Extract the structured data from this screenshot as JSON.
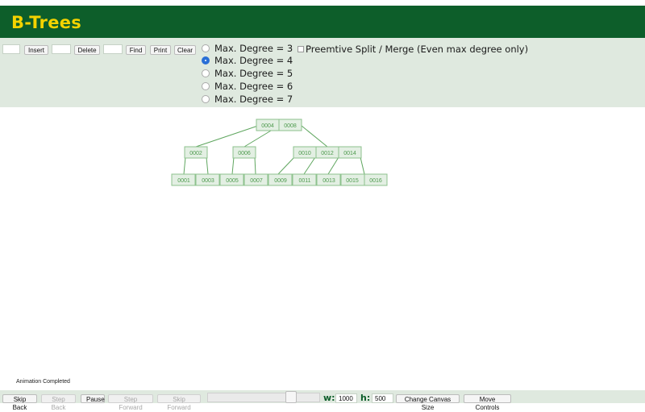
{
  "app": {
    "title": "B-Trees"
  },
  "controls": {
    "insert_label": "Insert",
    "delete_label": "Delete",
    "find_label": "Find",
    "print_label": "Print",
    "clear_label": "Clear",
    "insert_value": "",
    "delete_value": "",
    "find_value": "",
    "degrees": [
      {
        "label": "Max. Degree = 3",
        "selected": false
      },
      {
        "label": "Max. Degree = 4",
        "selected": true
      },
      {
        "label": "Max. Degree = 5",
        "selected": false
      },
      {
        "label": "Max. Degree = 6",
        "selected": false
      },
      {
        "label": "Max. Degree = 7",
        "selected": false
      }
    ],
    "preemptive_label": "Preemtive Split / Merge (Even max degree only)",
    "preemptive_checked": false
  },
  "tree": {
    "root": [
      "0004",
      "0008"
    ],
    "level1": [
      [
        "0002"
      ],
      [
        "0006"
      ],
      [
        "0010",
        "0012",
        "0014"
      ]
    ],
    "leaves": [
      "0001",
      "0003",
      "0005",
      "0007",
      "0009",
      "0011",
      "0013",
      "0015",
      "0016"
    ]
  },
  "status": {
    "text": "Animation Completed"
  },
  "bottom": {
    "skip_back": "Skip Back",
    "step_back": "Step Back",
    "pause": "Pause",
    "step_forward": "Step Forward",
    "skip_forward": "Skip Forward",
    "w_label": "w:",
    "w_value": "1000",
    "h_label": "h:",
    "h_value": "500",
    "change_canvas": "Change Canvas Size",
    "move_controls": "Move Controls"
  },
  "colors": {
    "header_bg": "#0d5e2a",
    "title": "#f4d300",
    "panel_bg": "#dfe9df",
    "node_fill": "#e3efe3",
    "node_stroke": "#8dc28d",
    "node_text": "#4d9a4d",
    "edge": "#5fa65f"
  }
}
